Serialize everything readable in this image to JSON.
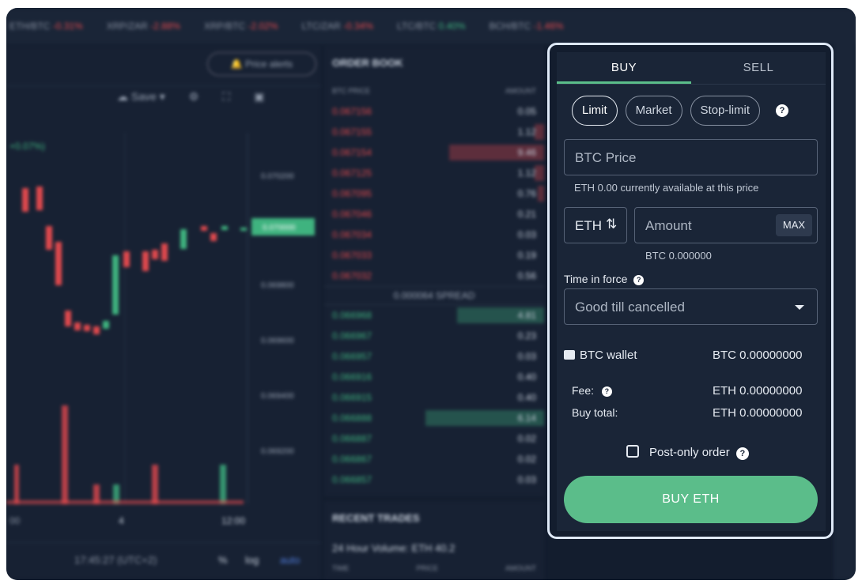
{
  "ticker": [
    {
      "pair": "ETH/BTC",
      "change": "-0.31%",
      "dir": "neg"
    },
    {
      "pair": "XRP/ZAR",
      "change": "-2.88%",
      "dir": "neg"
    },
    {
      "pair": "XRP/BTC",
      "change": "-2.02%",
      "dir": "neg"
    },
    {
      "pair": "LTC/ZAR",
      "change": "-0.34%",
      "dir": "neg"
    },
    {
      "pair": "LTC/BTC",
      "change": "0.40%",
      "dir": "pos"
    },
    {
      "pair": "BCH/BTC",
      "change": "-1.46%",
      "dir": "neg"
    }
  ],
  "chart": {
    "price_alerts_label": "Price alerts",
    "save_label": "Save",
    "change_label": "+0.07%)",
    "axis_prices": [
      "0.070200",
      "0.069800",
      "0.069600",
      "0.069400",
      "0.069200"
    ],
    "current_price": "0.070000",
    "time_labels": [
      "00",
      "4",
      "12:00"
    ],
    "clock": "17:45:27 (UTC+2)",
    "pct_label": "%",
    "log_label": "log",
    "auto_label": "auto"
  },
  "orderbook": {
    "title": "ORDER BOOK",
    "col_price": "BTC PRICE",
    "col_amount": "AMOUNT",
    "asks": [
      {
        "price": "0.067156",
        "amount": "0.05"
      },
      {
        "price": "0.067155",
        "amount": "1.12"
      },
      {
        "price": "0.067154",
        "amount": "9.46"
      },
      {
        "price": "0.067125",
        "amount": "1.12"
      },
      {
        "price": "0.067095",
        "amount": "0.76"
      },
      {
        "price": "0.067046",
        "amount": "0.21"
      },
      {
        "price": "0.067034",
        "amount": "0.03"
      },
      {
        "price": "0.067033",
        "amount": "0.19"
      },
      {
        "price": "0.067032",
        "amount": "0.56"
      }
    ],
    "spread": "0.000064 SPREAD",
    "bids": [
      {
        "price": "0.066968",
        "amount": "4.81"
      },
      {
        "price": "0.066967",
        "amount": "0.23"
      },
      {
        "price": "0.066957",
        "amount": "0.03"
      },
      {
        "price": "0.066916",
        "amount": "0.40"
      },
      {
        "price": "0.066915",
        "amount": "0.40"
      },
      {
        "price": "0.066888",
        "amount": "6.14"
      },
      {
        "price": "0.066887",
        "amount": "0.02"
      },
      {
        "price": "0.066867",
        "amount": "0.02"
      },
      {
        "price": "0.066857",
        "amount": "0.03"
      }
    ]
  },
  "recent_trades": {
    "title": "RECENT TRADES",
    "volume": "24 Hour Volume: ETH 40.2",
    "cols": [
      "TIME",
      "PRICE",
      "AMOUNT"
    ]
  },
  "panel": {
    "tab_buy": "BUY",
    "tab_sell": "SELL",
    "order_types": [
      "Limit",
      "Market",
      "Stop-limit"
    ],
    "help_glyph": "?",
    "price_placeholder": "BTC  Price",
    "available_hint": "ETH 0.00 currently available at this price",
    "currency_select": "ETH",
    "swap_glyph": "⇅",
    "amount_placeholder": "Amount",
    "max_label": "MAX",
    "btc_total_hint": "BTC 0.000000",
    "time_in_force_label": "Time in force",
    "time_in_force_value": "Good till cancelled",
    "wallet_label": "BTC wallet",
    "wallet_value": "BTC 0.00000000",
    "fee_label": "Fee:",
    "fee_value": "ETH 0.00000000",
    "buy_total_label": "Buy total:",
    "buy_total_value": "ETH 0.00000000",
    "post_only_label": "Post-only order",
    "buy_button": "BUY ETH"
  },
  "colors": {
    "accent_green": "#5bbd8a",
    "ask_red": "#e0494d",
    "bid_green": "#3fb37f",
    "panel_bg": "#1a2537"
  }
}
